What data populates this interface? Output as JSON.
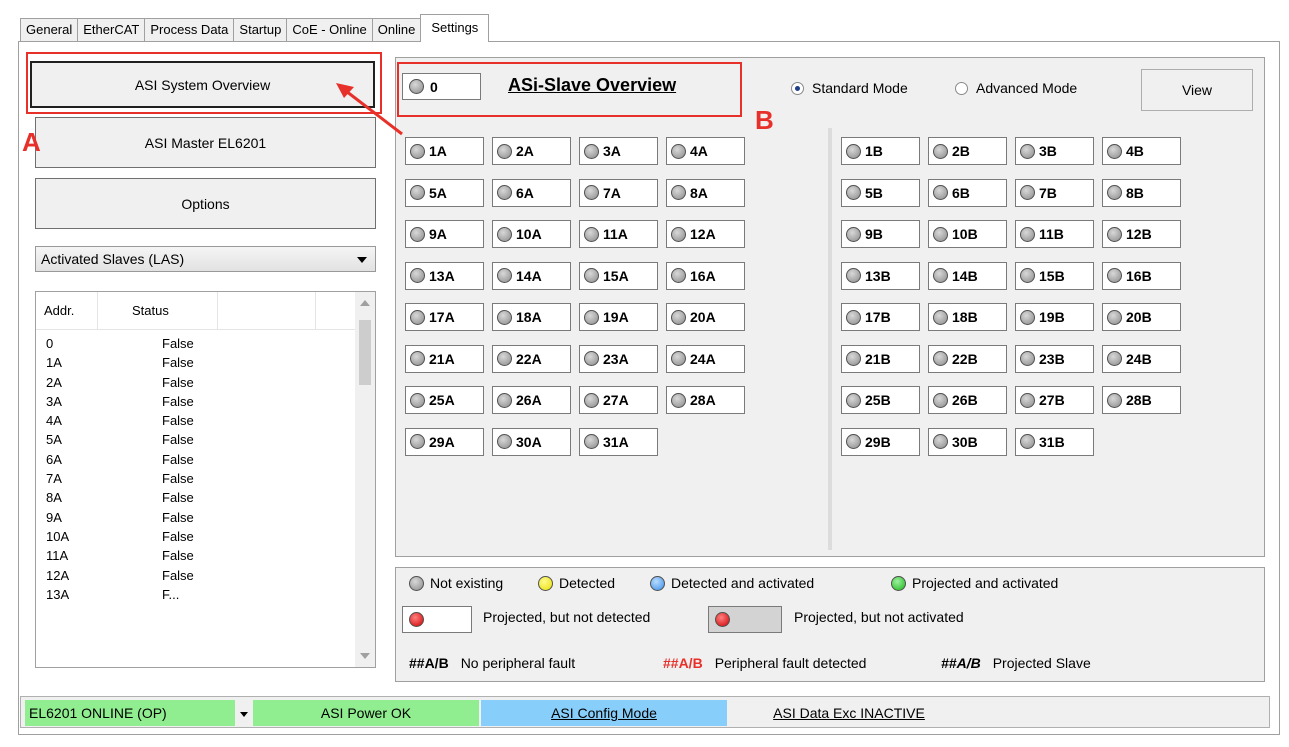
{
  "tabs": [
    {
      "label": "General"
    },
    {
      "label": "EtherCAT"
    },
    {
      "label": "Process Data"
    },
    {
      "label": "Startup"
    },
    {
      "label": "CoE - Online"
    },
    {
      "label": "Online"
    },
    {
      "label": "Settings"
    }
  ],
  "left": {
    "system_overview_label": "ASI System Overview",
    "master_label": "ASI Master EL6201",
    "options_label": "Options",
    "combo_value": "Activated Slaves (LAS)",
    "list_headers": {
      "addr": "Addr.",
      "status": "Status"
    },
    "rows": [
      {
        "addr": "0",
        "status": "False"
      },
      {
        "addr": "1A",
        "status": "False"
      },
      {
        "addr": "2A",
        "status": "False"
      },
      {
        "addr": "3A",
        "status": "False"
      },
      {
        "addr": "4A",
        "status": "False"
      },
      {
        "addr": "5A",
        "status": "False"
      },
      {
        "addr": "6A",
        "status": "False"
      },
      {
        "addr": "7A",
        "status": "False"
      },
      {
        "addr": "8A",
        "status": "False"
      },
      {
        "addr": "9A",
        "status": "False"
      },
      {
        "addr": "10A",
        "status": "False"
      },
      {
        "addr": "11A",
        "status": "False"
      },
      {
        "addr": "12A",
        "status": "False"
      },
      {
        "addr": "13A",
        "status": "F..."
      }
    ]
  },
  "annotations": {
    "a": "A",
    "b": "B",
    "accent": "#e8302a"
  },
  "overview": {
    "zero_label": "0",
    "title": "ASi-Slave Overview",
    "standard_mode": "Standard Mode",
    "advanced_mode": "Advanced Mode",
    "view_label": "View",
    "slaves_a": [
      "1A",
      "2A",
      "3A",
      "4A",
      "5A",
      "6A",
      "7A",
      "8A",
      "9A",
      "10A",
      "11A",
      "12A",
      "13A",
      "14A",
      "15A",
      "16A",
      "17A",
      "18A",
      "19A",
      "20A",
      "21A",
      "22A",
      "23A",
      "24A",
      "25A",
      "26A",
      "27A",
      "28A",
      "29A",
      "30A",
      "31A"
    ],
    "slaves_b": [
      "1B",
      "2B",
      "3B",
      "4B",
      "5B",
      "6B",
      "7B",
      "8B",
      "9B",
      "10B",
      "11B",
      "12B",
      "13B",
      "14B",
      "15B",
      "16B",
      "17B",
      "18B",
      "19B",
      "20B",
      "21B",
      "22B",
      "23B",
      "24B",
      "25B",
      "26B",
      "27B",
      "28B",
      "29B",
      "30B",
      "31B"
    ]
  },
  "legend": {
    "not_existing": "Not existing",
    "detected": "Detected",
    "detected_activated": "Detected and activated",
    "projected_activated": "Projected and activated",
    "projected_not_detected": "Projected, but not detected",
    "projected_not_activated": "Projected, but not activated",
    "hash_label": "##A/B",
    "no_fault": "No peripheral fault",
    "fault": "Peripheral fault detected",
    "projected_slave": "Projected Slave"
  },
  "status": {
    "online": "EL6201 ONLINE (OP)",
    "power": "ASI Power OK",
    "config_mode": "ASI Config Mode",
    "data_exc": "ASI Data Exc INACTIVE",
    "colors": {
      "online": "#90ee90",
      "power": "#90ee90",
      "config": "#87cefa"
    }
  }
}
